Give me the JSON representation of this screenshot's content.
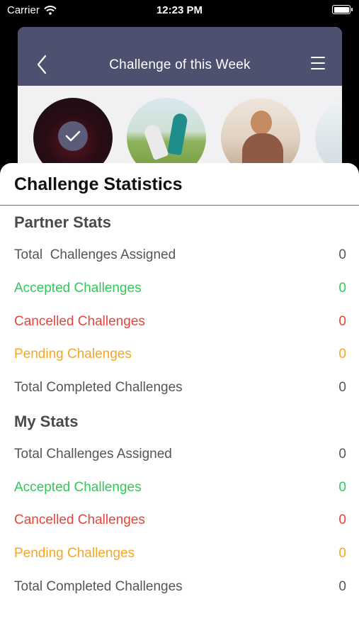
{
  "status_bar": {
    "carrier": "Carrier",
    "time": "12:23 PM"
  },
  "background": {
    "title": "Challenge of  this Week",
    "icons": {
      "back": "chevron-left-icon",
      "menu": "hamburger-menu-icon"
    }
  },
  "sheet": {
    "title": "Challenge Statistics"
  },
  "colors": {
    "neutral": "#555555",
    "accepted": "#34c759",
    "cancelled": "#e5453a",
    "pending": "#f5a623"
  },
  "partner_stats": {
    "title": "Partner Stats",
    "rows": [
      {
        "label": "Total  Challenges Assigned",
        "value": "0",
        "tone": "neutral"
      },
      {
        "label": "Accepted Challenges",
        "value": "0",
        "tone": "accepted"
      },
      {
        "label": "Cancelled Challenges",
        "value": "0",
        "tone": "cancelled"
      },
      {
        "label": "Pending Chalenges",
        "value": "0",
        "tone": "pending"
      },
      {
        "label": "Total Completed Challenges",
        "value": "0",
        "tone": "neutral"
      }
    ]
  },
  "my_stats": {
    "title": "My Stats",
    "rows": [
      {
        "label": "Total Challenges Assigned",
        "value": "0",
        "tone": "neutral"
      },
      {
        "label": "Accepted Challenges",
        "value": "0",
        "tone": "accepted"
      },
      {
        "label": "Cancelled Challenges",
        "value": "0",
        "tone": "cancelled"
      },
      {
        "label": "Pending Challenges",
        "value": "0",
        "tone": "pending"
      },
      {
        "label": "Total Completed Challenges",
        "value": "0",
        "tone": "neutral"
      }
    ]
  }
}
